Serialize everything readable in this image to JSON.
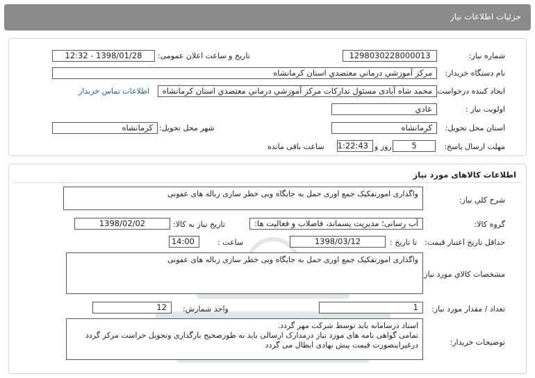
{
  "header": {
    "title": "جزئیات اطلاعات نیاز"
  },
  "need_info": {
    "need_number_label": "شماره نیاز:",
    "need_number": "1298030228000013",
    "announce_label": "تاریخ و ساعت اعلان عمومی:",
    "announce_value": "1398/01/28 - 12:32",
    "buyer_org_label": "نام دستگاه خریدار:",
    "buyer_org": "مرکز آموزشي درماني معتضدي استان کرمانشاه",
    "requester_label": "ایجاد کننده درخواست:",
    "requester": "محمد شاه آبادی مسئول تدارکات مرکز آموزشي درماني معتضدي استان کرمانشاه",
    "contact_link": "اطلاعات تماس خریدار",
    "priority_label": "اولویت نیاز :",
    "priority": "عادي",
    "province_label": "استان محل تحویل:",
    "province": "کرمانشاه",
    "city_label": "شهر محل تحویل:",
    "city": "کرمانشاه",
    "deadline_label": "مهلت ارسال پاسخ:",
    "days_value": "5",
    "days_word": "روز و",
    "time_remaining": "01:22:43",
    "remaining_word": "ساعت باقی مانده"
  },
  "goods": {
    "section_title": "اطلاعات کالاهای مورد نیاز",
    "summary_label": "شرح کلي نیاز:",
    "summary": "واگذاری امورتفکیک جمع اوری حمل به جایگاه وبی خطر سازی زباله های عفونی",
    "group_label": "گروه کالا:",
    "group": "آب رسانی؛ مدیریت پسماند، فاضلاب و فعالیت ها:",
    "need_date_label": "تاریخ نیاز به کالا:",
    "need_date": "1398/02/02",
    "validity_label": "حداقل تاریخ اعتبار قیمت:",
    "until_date_label": "تا تاریخ :",
    "until_date": "1398/03/12",
    "hour_label": "ساعت :",
    "hour": "14:00",
    "specs_label": "مشخصات کالاي مورد نیاز:",
    "specs": "واگذاری امورتفکیک جمع اوری حمل به جایگاه وبی خطر سازی زباله های عفونی",
    "qty_label": "تعداد / مقدار مورد نیاز:",
    "qty": "1",
    "unit_label": "واحد شمارش:",
    "unit": "12",
    "buyer_notes_label": "توضیحات خریدار:",
    "buyer_notes": "اسناد درسامانه باید توسط شرکت مهر گردد.\nتمامی گواهی نامه های مورد نیاز درمدارک ارسالی باید به طورصحیح بارگذاری وتحویل حراست مرکز گردد درغیراینصورت قیمت پیش نهادی ابطال می گردد"
  },
  "colors": {
    "header_bg": "#8a8a8a",
    "link": "#1f5fb4",
    "watermark": "#7a8fa6"
  },
  "icons": {
    "watermark": "parsnamaddata-watermark"
  }
}
